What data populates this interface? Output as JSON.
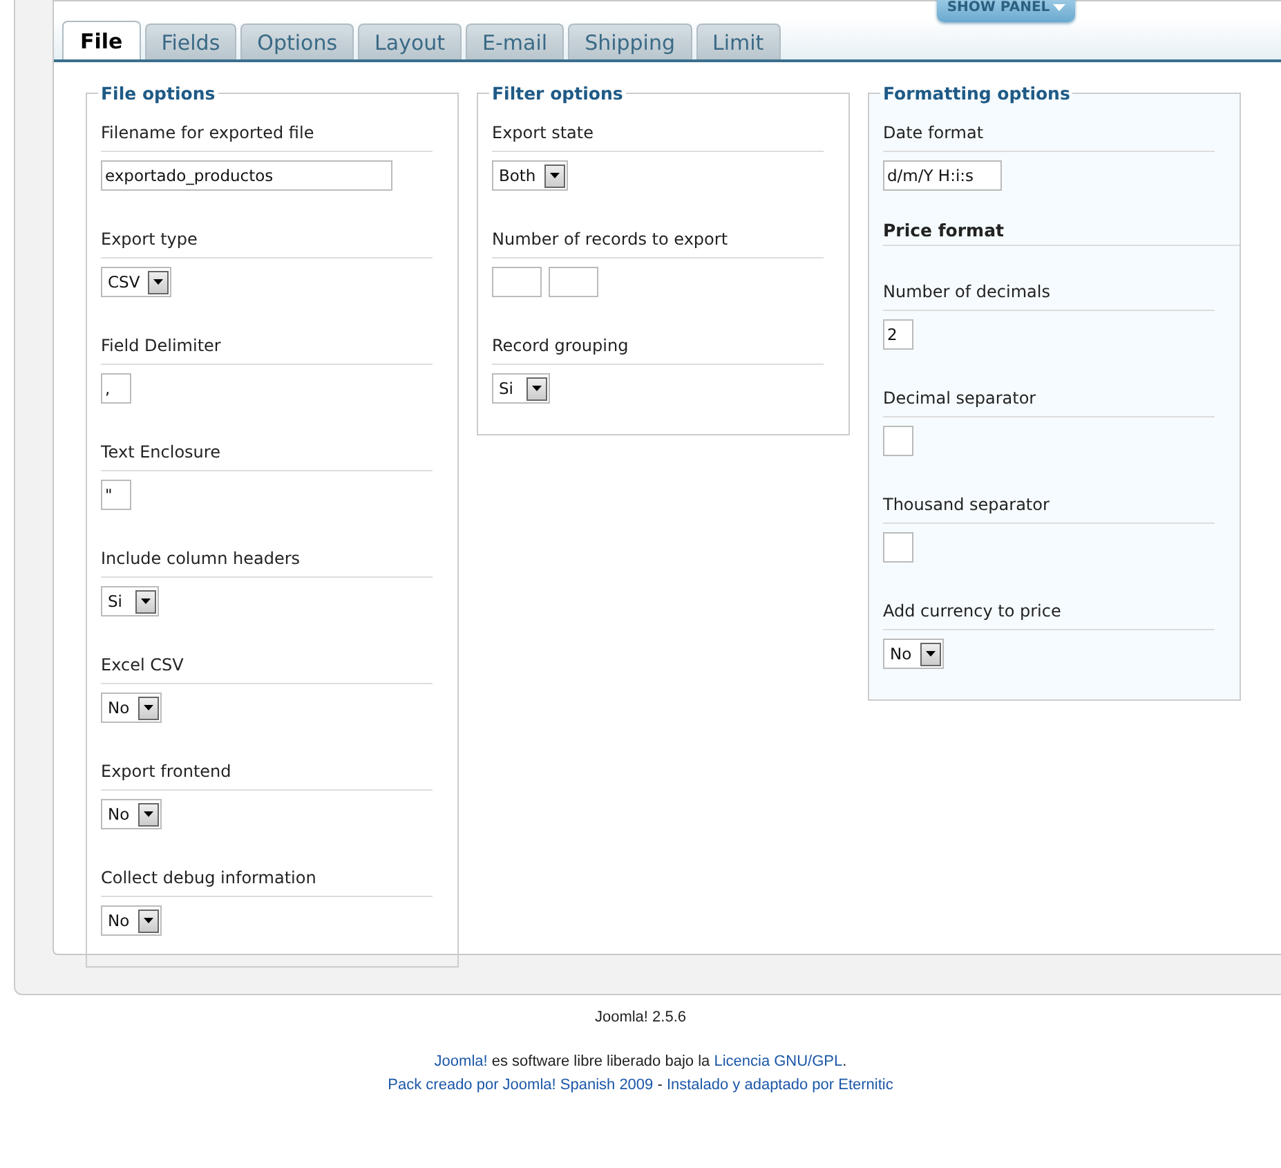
{
  "show_panel": {
    "label": "SHOW PANEL"
  },
  "tabs": [
    {
      "label": "File",
      "selected": true
    },
    {
      "label": "Fields",
      "selected": false
    },
    {
      "label": "Options",
      "selected": false
    },
    {
      "label": "Layout",
      "selected": false
    },
    {
      "label": "E-mail",
      "selected": false
    },
    {
      "label": "Shipping",
      "selected": false
    },
    {
      "label": "Limit",
      "selected": false
    }
  ],
  "fieldsets": [
    {
      "legend": "File options",
      "kind": "plain",
      "items": [
        {
          "kind": "field",
          "label": "Filename for exported file",
          "control": {
            "kind": "longinput",
            "value": "exportado_productos"
          }
        },
        {
          "kind": "field",
          "label": "Export type",
          "control": {
            "kind": "select",
            "value": "CSV"
          }
        },
        {
          "kind": "field",
          "label": "Field Delimiter",
          "control": {
            "kind": "tinyinput",
            "value": ","
          }
        },
        {
          "kind": "field",
          "label": "Text Enclosure",
          "control": {
            "kind": "tinyinput",
            "value": "\""
          }
        },
        {
          "kind": "field",
          "label": "Include column headers",
          "control": {
            "kind": "select",
            "value": "Si"
          }
        },
        {
          "kind": "field",
          "label": "Excel CSV",
          "control": {
            "kind": "select",
            "value": "No"
          }
        },
        {
          "kind": "field",
          "label": "Export frontend",
          "control": {
            "kind": "select",
            "value": "No"
          }
        },
        {
          "kind": "field",
          "label": "Collect debug information",
          "control": {
            "kind": "select",
            "value": "No"
          }
        }
      ]
    },
    {
      "legend": "Filter options",
      "kind": "plain",
      "items": [
        {
          "kind": "field",
          "label": "Export state",
          "control": {
            "kind": "select",
            "value": "Both"
          }
        },
        {
          "kind": "field",
          "label": "Number of records to export",
          "control": {
            "kind": "pair"
          }
        },
        {
          "kind": "field",
          "label": "Record grouping",
          "control": {
            "kind": "select",
            "value": "Si"
          }
        }
      ]
    },
    {
      "legend": "Formatting options",
      "kind": "tinted",
      "items": [
        {
          "kind": "field",
          "label": "Date format",
          "control": {
            "kind": "input",
            "value": "d/m/Y H:i:s"
          }
        },
        {
          "kind": "heading",
          "label": "Price format"
        },
        {
          "kind": "field",
          "label": "Number of decimals",
          "control": {
            "kind": "tinyinput",
            "value": "2"
          }
        },
        {
          "kind": "field",
          "label": "Decimal separator",
          "control": {
            "kind": "tinyinput"
          }
        },
        {
          "kind": "field",
          "label": "Thousand separator",
          "control": {
            "kind": "tinyinput"
          }
        },
        {
          "kind": "field",
          "label": "Add currency to price",
          "control": {
            "kind": "select",
            "value": "No"
          }
        }
      ]
    }
  ],
  "footer": {
    "version": "Joomla! 2.5.6",
    "license": [
      {
        "text": "Joomla!",
        "kind": "link"
      },
      {
        "text": " es software libre liberado bajo la ",
        "kind": "text"
      },
      {
        "text": "Licencia GNU/GPL",
        "kind": "link"
      },
      {
        "text": ".",
        "kind": "text"
      }
    ],
    "credits": [
      {
        "text": "Pack creado por Joomla! Spanish 2009",
        "kind": "link"
      },
      {
        "text": " - ",
        "kind": "text"
      },
      {
        "text": "Instalado y adaptado por Eternitic",
        "kind": "link"
      }
    ]
  }
}
